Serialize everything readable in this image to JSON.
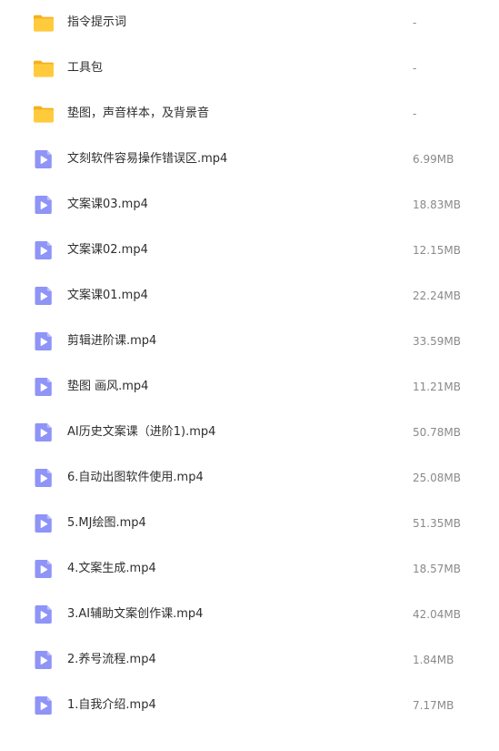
{
  "colors": {
    "folder": "#ffcb3d",
    "folder_tab": "#f5b120",
    "video": "#8f94f7",
    "video_play": "#ffffff",
    "name_text": "#2e2e2e",
    "size_text": "#8a8a8a"
  },
  "files": [
    {
      "type": "folder",
      "icon": "folder-icon",
      "name": "指令提示词",
      "size": "-"
    },
    {
      "type": "folder",
      "icon": "folder-icon",
      "name": "工具包",
      "size": "-"
    },
    {
      "type": "folder",
      "icon": "folder-icon",
      "name": "垫图，声音样本，及背景音",
      "size": "-"
    },
    {
      "type": "video",
      "icon": "video-file-icon",
      "name": "文刻软件容易操作错误区.mp4",
      "size": "6.99MB"
    },
    {
      "type": "video",
      "icon": "video-file-icon",
      "name": "文案课03.mp4",
      "size": "18.83MB"
    },
    {
      "type": "video",
      "icon": "video-file-icon",
      "name": "文案课02.mp4",
      "size": "12.15MB"
    },
    {
      "type": "video",
      "icon": "video-file-icon",
      "name": "文案课01.mp4",
      "size": "22.24MB"
    },
    {
      "type": "video",
      "icon": "video-file-icon",
      "name": "剪辑进阶课.mp4",
      "size": "33.59MB"
    },
    {
      "type": "video",
      "icon": "video-file-icon",
      "name": "垫图 画风.mp4",
      "size": "11.21MB"
    },
    {
      "type": "video",
      "icon": "video-file-icon",
      "name": "AI历史文案课（进阶1).mp4",
      "size": "50.78MB"
    },
    {
      "type": "video",
      "icon": "video-file-icon",
      "name": "6.自动出图软件使用.mp4",
      "size": "25.08MB"
    },
    {
      "type": "video",
      "icon": "video-file-icon",
      "name": "5.MJ绘图.mp4",
      "size": "51.35MB"
    },
    {
      "type": "video",
      "icon": "video-file-icon",
      "name": "4.文案生成.mp4",
      "size": "18.57MB"
    },
    {
      "type": "video",
      "icon": "video-file-icon",
      "name": "3.AI辅助文案创作课.mp4",
      "size": "42.04MB"
    },
    {
      "type": "video",
      "icon": "video-file-icon",
      "name": "2.养号流程.mp4",
      "size": "1.84MB"
    },
    {
      "type": "video",
      "icon": "video-file-icon",
      "name": "1.自我介绍.mp4",
      "size": "7.17MB"
    }
  ]
}
